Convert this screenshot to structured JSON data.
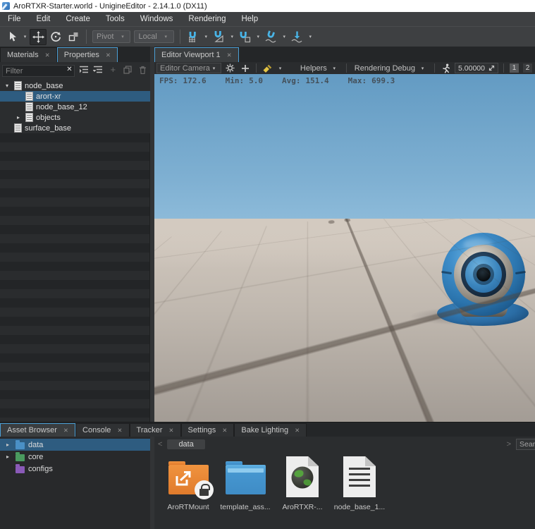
{
  "icons": {
    "close": "✕",
    "caret": "▾",
    "expand_down": "▾",
    "expand_right": "▸",
    "chevron_left": "<",
    "chevron_right": ">",
    "plus": "+"
  },
  "window": {
    "title": "AroRTXR-Starter.world - UnigineEditor - 2.14.1.0 (DX11)"
  },
  "menu": {
    "items": [
      "File",
      "Edit",
      "Create",
      "Tools",
      "Windows",
      "Rendering",
      "Help"
    ]
  },
  "toolbar": {
    "pivot": "Pivot",
    "space": "Local"
  },
  "left_panel": {
    "tabs": [
      {
        "label": "Materials"
      },
      {
        "label": "Properties"
      }
    ],
    "filter_placeholder": "Filter",
    "tree": [
      {
        "label": "node_base"
      },
      {
        "label": "arort-xr"
      },
      {
        "label": "node_base_12"
      },
      {
        "label": "objects"
      },
      {
        "label": "surface_base"
      }
    ]
  },
  "viewport": {
    "tab": "Editor Viewport 1",
    "camera": "Editor Camera",
    "helpers": "Helpers",
    "rendering_debug": "Rendering Debug",
    "speed": "5.00000",
    "view1": "1",
    "view2": "2",
    "stats": {
      "fps_label": "FPS:",
      "fps_value": "172.6",
      "min_label": "Min:",
      "min_value": "5.0",
      "avg_label": "Avg:",
      "avg_value": "151.4",
      "max_label": "Max:",
      "max_value": "699.3"
    }
  },
  "bottom_panel": {
    "tabs": [
      {
        "label": "Asset Browser"
      },
      {
        "label": "Console"
      },
      {
        "label": "Tracker"
      },
      {
        "label": "Settings"
      },
      {
        "label": "Bake Lighting"
      }
    ],
    "tree": [
      {
        "label": "data"
      },
      {
        "label": "core"
      },
      {
        "label": "configs"
      }
    ],
    "breadcrumb": "data",
    "search_placeholder": "Search",
    "assets": [
      {
        "label": "AroRTMount"
      },
      {
        "label": "template_ass..."
      },
      {
        "label": "AroRTXR-..."
      },
      {
        "label": "node_base_1..."
      }
    ]
  },
  "colors": {
    "accent": "#4b9fd5",
    "selection": "#2e5c80",
    "sky_top": "#639bc3",
    "ground": "#c0b8af"
  }
}
